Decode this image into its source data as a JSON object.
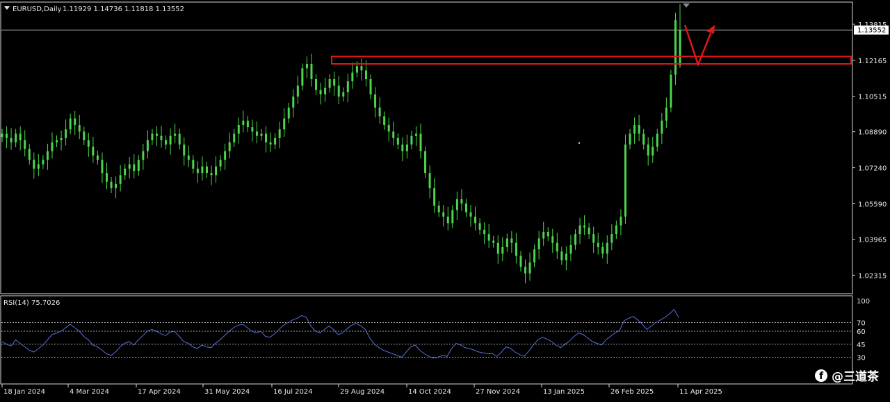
{
  "header": {
    "symbol_timeframe": "EURUSD,Daily",
    "ohlc": "1.11929 1.14736 1.11818 1.13552"
  },
  "rsi_label": "RSI(14) 75.7026",
  "current_price_tag": "1.13552",
  "watermark": {
    "icon": "facebook-icon",
    "text": "@三道茶"
  },
  "colors": {
    "background": "#000000",
    "candles": "#4CD64C",
    "rsi_line": "#5A6FD8",
    "annotation": "#E01818",
    "grid_text": "#E8E8E8"
  },
  "chart_data": [
    {
      "type": "candlestick",
      "symbol": "EURUSD",
      "timeframe": "Daily",
      "ylim": [
        1.015,
        1.148
      ],
      "y_ticks": [
        "1.13815",
        "1.12165",
        "1.10515",
        "1.08890",
        "1.07240",
        "1.05590",
        "1.03965",
        "1.02315"
      ],
      "x_ticks": [
        "18 Jan 2024",
        "4 Mar 2024",
        "17 Apr 2024",
        "31 May 2024",
        "16 Jul 2024",
        "29 Aug 2024",
        "14 Oct 2024",
        "27 Nov 2024",
        "13 Jan 2025",
        "26 Feb 2025",
        "11 Apr 2025"
      ],
      "current_price": 1.13552,
      "last_bar": {
        "open": 1.11929,
        "high": 1.14736,
        "low": 1.11818,
        "close": 1.13552
      },
      "closes": [
        1.088,
        1.086,
        1.084,
        1.088,
        1.085,
        1.081,
        1.076,
        1.072,
        1.074,
        1.076,
        1.08,
        1.084,
        1.085,
        1.086,
        1.09,
        1.095,
        1.092,
        1.089,
        1.085,
        1.082,
        1.078,
        1.076,
        1.07,
        1.066,
        1.063,
        1.065,
        1.069,
        1.072,
        1.074,
        1.071,
        1.076,
        1.08,
        1.085,
        1.088,
        1.087,
        1.085,
        1.083,
        1.087,
        1.088,
        1.083,
        1.078,
        1.076,
        1.072,
        1.07,
        1.073,
        1.07,
        1.069,
        1.073,
        1.076,
        1.08,
        1.084,
        1.088,
        1.092,
        1.094,
        1.091,
        1.089,
        1.087,
        1.088,
        1.084,
        1.083,
        1.086,
        1.09,
        1.095,
        1.1,
        1.105,
        1.11,
        1.118,
        1.12,
        1.113,
        1.108,
        1.106,
        1.109,
        1.113,
        1.11,
        1.105,
        1.107,
        1.112,
        1.116,
        1.119,
        1.117,
        1.113,
        1.106,
        1.1,
        1.096,
        1.092,
        1.089,
        1.086,
        1.083,
        1.08,
        1.083,
        1.087,
        1.088,
        1.08,
        1.07,
        1.063,
        1.055,
        1.052,
        1.05,
        1.047,
        1.053,
        1.058,
        1.056,
        1.052,
        1.05,
        1.047,
        1.044,
        1.042,
        1.039,
        1.038,
        1.033,
        1.036,
        1.04,
        1.038,
        1.032,
        1.027,
        1.024,
        1.029,
        1.035,
        1.04,
        1.043,
        1.041,
        1.038,
        1.034,
        1.03,
        1.033,
        1.037,
        1.042,
        1.046,
        1.045,
        1.042,
        1.038,
        1.036,
        1.033,
        1.038,
        1.042,
        1.046,
        1.05,
        1.083,
        1.088,
        1.092,
        1.088,
        1.083,
        1.078,
        1.082,
        1.088,
        1.094,
        1.1,
        1.115,
        1.14,
        1.1355
      ]
    },
    {
      "type": "line",
      "name": "RSI(14)",
      "current_value": 75.7026,
      "ylim": [
        0,
        100
      ],
      "y_ticks": [
        "100",
        "70",
        "60",
        "45",
        "30"
      ],
      "levels": [
        70,
        60,
        45,
        30
      ],
      "values": [
        48,
        45,
        43,
        50,
        46,
        42,
        38,
        36,
        40,
        44,
        50,
        56,
        58,
        60,
        64,
        68,
        64,
        60,
        54,
        50,
        44,
        42,
        38,
        34,
        32,
        36,
        42,
        46,
        48,
        44,
        50,
        55,
        60,
        62,
        60,
        57,
        55,
        59,
        60,
        54,
        48,
        46,
        42,
        40,
        44,
        42,
        41,
        46,
        50,
        55,
        60,
        64,
        67,
        68,
        64,
        60,
        58,
        60,
        54,
        53,
        57,
        62,
        67,
        70,
        73,
        75,
        78,
        76,
        66,
        60,
        58,
        62,
        66,
        62,
        56,
        58,
        63,
        67,
        69,
        66,
        62,
        52,
        45,
        41,
        38,
        36,
        34,
        32,
        30,
        36,
        42,
        44,
        38,
        34,
        31,
        29,
        30,
        32,
        31,
        40,
        46,
        44,
        41,
        40,
        38,
        36,
        35,
        34,
        34,
        31,
        36,
        42,
        40,
        36,
        33,
        31,
        37,
        44,
        50,
        53,
        51,
        48,
        44,
        41,
        45,
        49,
        54,
        58,
        56,
        52,
        48,
        46,
        44,
        50,
        54,
        58,
        61,
        72,
        75,
        77,
        73,
        68,
        62,
        66,
        70,
        73,
        76,
        80,
        85,
        76
      ]
    }
  ]
}
